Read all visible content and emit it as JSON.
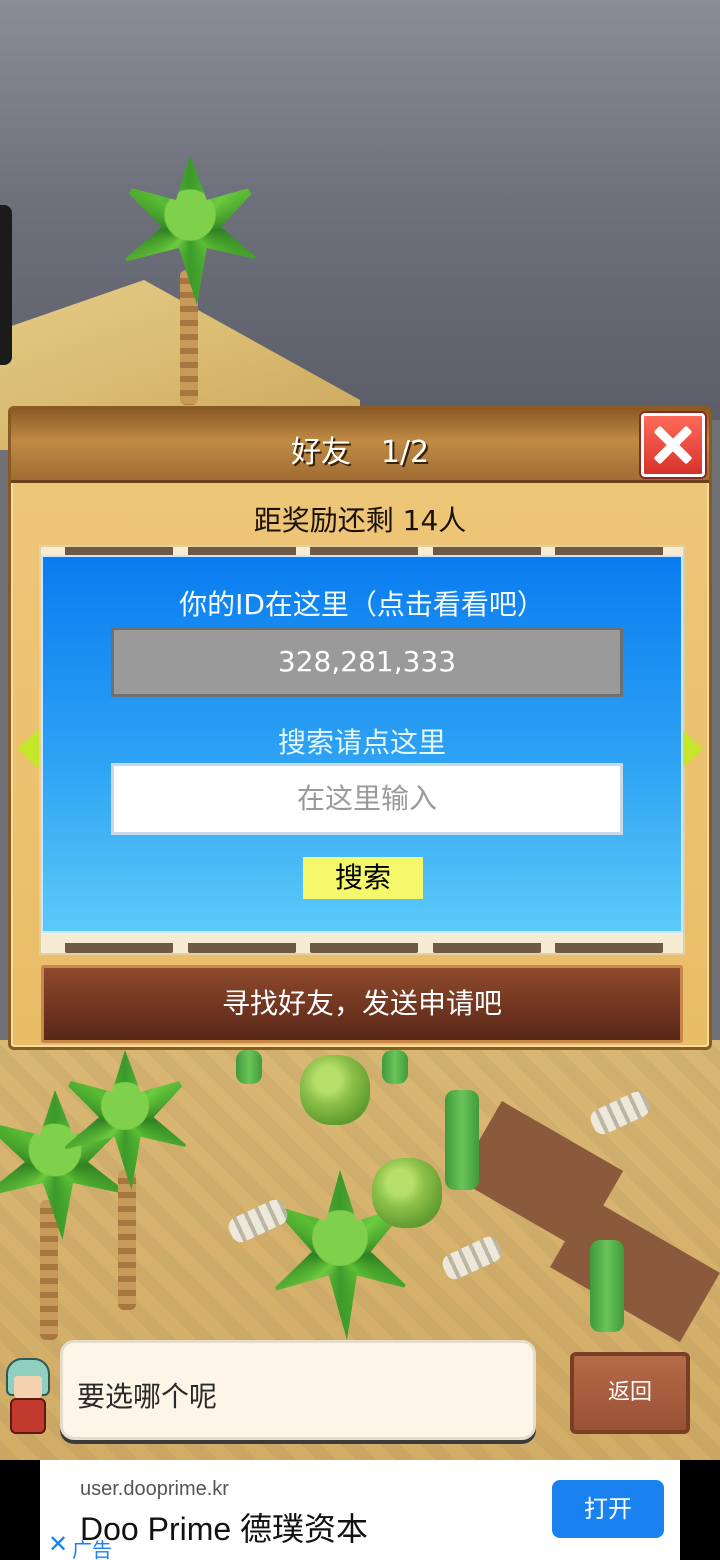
{
  "dialog": {
    "title": "好友　1/2",
    "reward_text": "距奖励还剩 14人",
    "id_caption": "你的ID在这里（点击看看吧）",
    "player_id": "328,281,333",
    "search_caption": "搜索请点这里",
    "search_placeholder": "在这里输入",
    "search_button": "搜索",
    "find_friends_button": "寻找好友，发送申请吧"
  },
  "bottom_bar": {
    "speech_text": "要选哪个呢",
    "back_button": "返回"
  },
  "ad": {
    "url": "user.dooprime.kr",
    "title": "Doo Prime 德璞资本",
    "open_button": "打开",
    "label": "广告"
  },
  "colors": {
    "panel_blue": "#0a7cf0",
    "close_red": "#d7322a",
    "search_button_yellow": "#f4f86a",
    "ad_button_blue": "#1a82f0"
  }
}
